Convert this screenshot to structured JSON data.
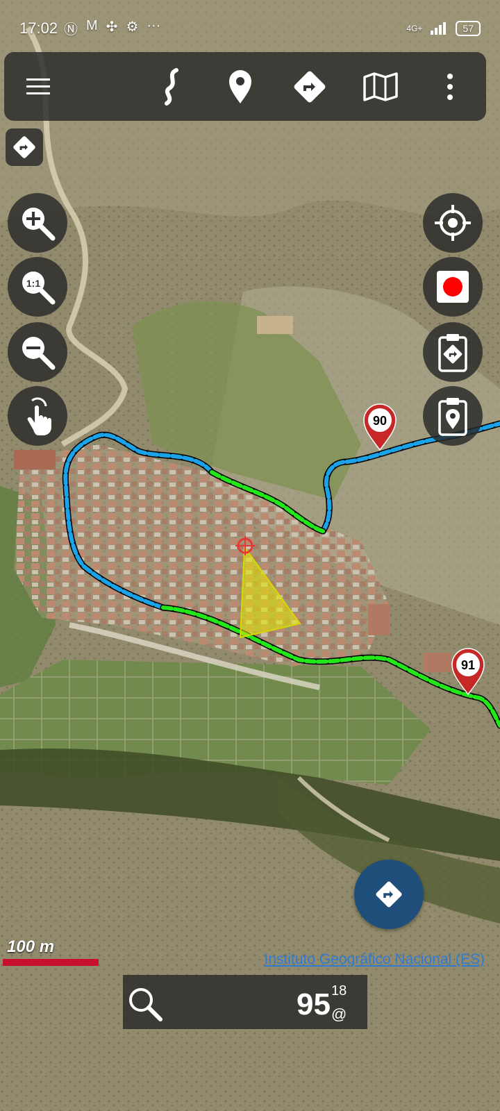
{
  "status_bar": {
    "time": "17:02",
    "notification_icons": [
      "nfc-icon",
      "gmail-icon",
      "fan-icon",
      "settings-icon",
      "more-icon"
    ],
    "network": "4G+",
    "battery": "57"
  },
  "toolbar": {
    "buttons": [
      "menu-icon",
      "track-icon",
      "waypoint-icon",
      "route-icon",
      "map-layers-icon",
      "overflow-icon"
    ]
  },
  "map": {
    "waypoints": [
      {
        "label": "90"
      },
      {
        "label": "91"
      }
    ],
    "scale_label": "100 m",
    "attribution": "Instituto Geográfico Nacional (ES)",
    "colors": {
      "track_blue": "#1aa3e8",
      "track_green": "#22e81a",
      "position_cone": "#e8e800",
      "position_marker": "#e53935",
      "waypoint_red": "#c62828",
      "scale_bar": "#c8102e",
      "fab": "#1e4e79"
    }
  },
  "left_controls": [
    "zoom-in-icon",
    "zoom-1-to-1-icon",
    "zoom-out-icon",
    "touch-icon"
  ],
  "right_controls": [
    "center-location-icon",
    "record-icon",
    "route-clipboard-icon",
    "waypoint-clipboard-icon"
  ],
  "bottom_bar": {
    "speed_value": "95",
    "speed_superscript": "18",
    "speed_subscript": "@"
  }
}
